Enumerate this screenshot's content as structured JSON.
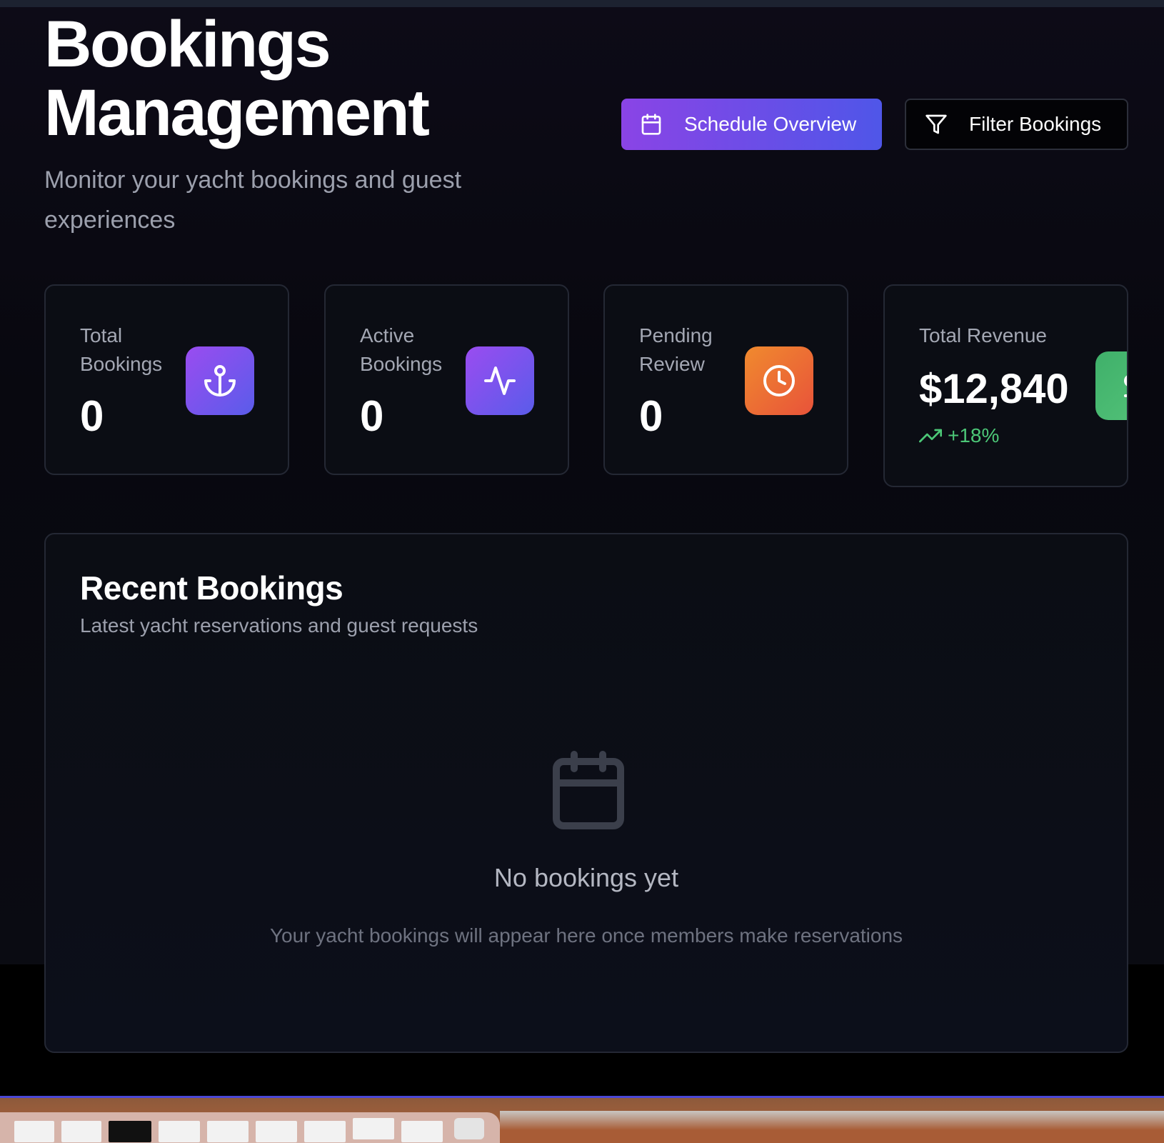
{
  "header": {
    "title_line1": "Bookings",
    "title_line2": "Management",
    "subtitle": "Monitor your yacht bookings and guest experiences"
  },
  "actions": {
    "schedule_label": "Schedule Overview",
    "schedule_icon": "calendar-icon",
    "filter_label": "Filter Bookings",
    "filter_icon": "filter-icon"
  },
  "stats": [
    {
      "label": "Total Bookings",
      "value": "0",
      "icon": "anchor-icon",
      "color": "#7b52ee"
    },
    {
      "label": "Active Bookings",
      "value": "0",
      "icon": "activity-icon",
      "color": "#7b52ee"
    },
    {
      "label": "Pending Review",
      "value": "0",
      "icon": "clock-icon",
      "color": "#ec6e34"
    },
    {
      "label": "Total Revenue",
      "value": "$12,840",
      "icon": "dollar-icon",
      "color": "#48b870",
      "trend": "+18%",
      "trend_icon": "trending-up-icon"
    }
  ],
  "recent": {
    "title": "Recent Bookings",
    "subtitle": "Latest yacht reservations and guest requests",
    "empty_title": "No bookings yet",
    "empty_desc": "Your yacht bookings will appear here once members make reservations",
    "empty_icon": "calendar-icon"
  },
  "theme": {
    "accent_start": "#8a44e6",
    "accent_end": "#4f56e8",
    "positive": "#4cc777"
  }
}
